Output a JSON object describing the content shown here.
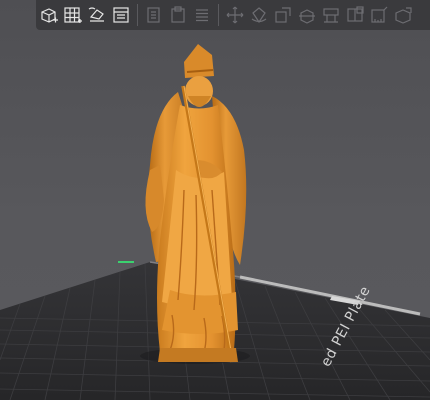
{
  "toolbar": {
    "buttons": [
      {
        "icon": "add-object-icon",
        "enabled": true
      },
      {
        "icon": "arrange-grid-icon",
        "enabled": true
      },
      {
        "icon": "orient-icon",
        "enabled": true
      },
      {
        "icon": "plate-icon",
        "enabled": true
      },
      {
        "icon": "copy-icon",
        "enabled": false
      },
      {
        "icon": "paste-icon",
        "enabled": false
      },
      {
        "icon": "list-icon",
        "enabled": false
      },
      {
        "icon": "move-icon",
        "enabled": false
      },
      {
        "icon": "rotate-icon",
        "enabled": false
      },
      {
        "icon": "scale-icon",
        "enabled": false
      },
      {
        "icon": "cut-icon",
        "enabled": false
      },
      {
        "icon": "support-icon",
        "enabled": false
      },
      {
        "icon": "seam-icon",
        "enabled": false
      },
      {
        "icon": "measure-icon",
        "enabled": false
      },
      {
        "icon": "assembly-icon",
        "enabled": false
      }
    ]
  },
  "plate": {
    "label": "ed PEI Plate"
  },
  "colors": {
    "model": "#e29532",
    "viewport_bg": "#535357",
    "bed": "#2c2c2f",
    "bed_grid": "#3d3d40",
    "toolbar_bg": "#3a3a3d",
    "axis_green": "#3bd16f"
  }
}
